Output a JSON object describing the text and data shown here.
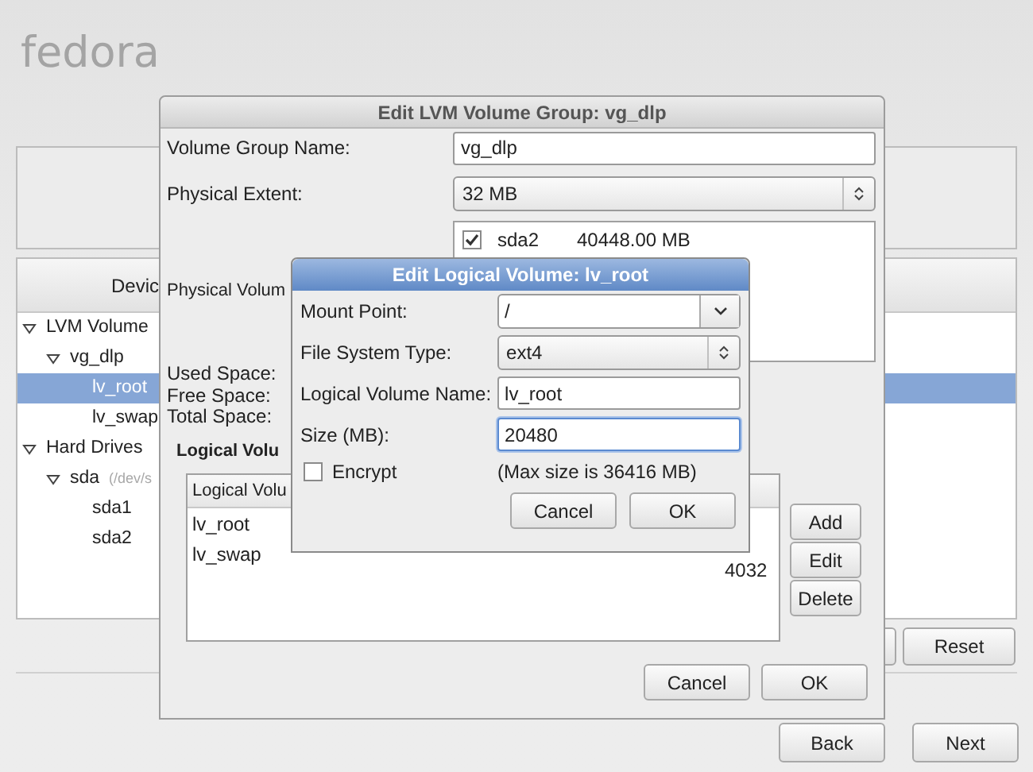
{
  "logo": "fedora",
  "devices": {
    "header": "Devic",
    "tree": [
      {
        "label": "LVM Volume",
        "expanded": true,
        "selected": false,
        "children": [
          {
            "label": "vg_dlp",
            "expanded": true,
            "selected": false,
            "children": [
              {
                "label": "lv_root",
                "selected": true
              },
              {
                "label": "lv_swap",
                "selected": false
              }
            ]
          }
        ]
      },
      {
        "label": "Hard Drives",
        "expanded": true,
        "selected": false,
        "children": [
          {
            "label": "sda",
            "detail": "(/dev/s",
            "expanded": true,
            "selected": false,
            "children": [
              {
                "label": "sda1",
                "selected": false
              },
              {
                "label": "sda2",
                "selected": false
              }
            ]
          }
        ]
      }
    ]
  },
  "panel_buttons": [
    "Reset"
  ],
  "nav_buttons": [
    "Back",
    "Next"
  ],
  "vg_dialog": {
    "title": "Edit LVM Volume Group: vg_dlp",
    "name_label": "Volume Group Name:",
    "name_value": "vg_dlp",
    "extent_label": "Physical Extent:",
    "extent_value": "32 MB",
    "pv_label": "Physical Volum",
    "pvs": [
      {
        "checked": true,
        "name": "sda2",
        "size": "40448.00 MB"
      }
    ],
    "space_labels": [
      "Used Space:",
      "Free Space:",
      "Total Space:"
    ],
    "lv_heading": "Logical Volu",
    "lv_table": {
      "header": "Logical Volu",
      "rows": [
        {
          "name": "lv_root",
          "size": ""
        },
        {
          "name": "lv_swap",
          "size": "4032"
        }
      ]
    },
    "side_buttons": [
      "Add",
      "Edit",
      "Delete"
    ],
    "buttons": [
      "Cancel",
      "OK"
    ]
  },
  "lv_dialog": {
    "title": "Edit Logical Volume: lv_root",
    "fields": [
      {
        "kind": "combo",
        "label": "Mount Point:",
        "value": "/",
        "focused": false
      },
      {
        "kind": "select",
        "label": "File System Type:",
        "value": "ext4",
        "focused": false
      },
      {
        "kind": "text",
        "label": "Logical Volume Name:",
        "value": "lv_root",
        "focused": false
      },
      {
        "kind": "text",
        "label": "Size (MB):",
        "value": "20480",
        "focused": true
      }
    ],
    "encrypt": {
      "label": "Encrypt",
      "checked": false
    },
    "max_note": "(Max size is 36416 MB)",
    "buttons": [
      "Cancel",
      "OK"
    ]
  }
}
